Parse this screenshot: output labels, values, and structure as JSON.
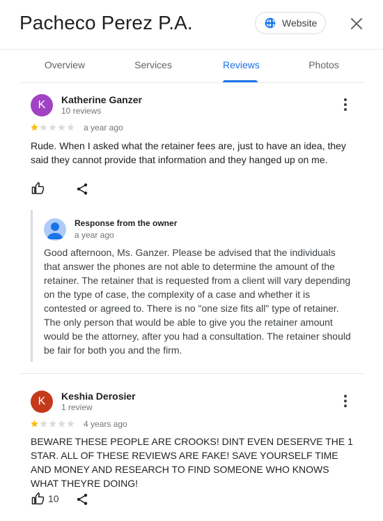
{
  "header": {
    "title": "Pacheco Perez P.A.",
    "website_label": "Website",
    "website_icon": "globe-icon",
    "close_icon": "close-icon"
  },
  "tabs": [
    {
      "label": "Overview",
      "active": false
    },
    {
      "label": "Services",
      "active": false
    },
    {
      "label": "Reviews",
      "active": true
    },
    {
      "label": "Photos",
      "active": false
    }
  ],
  "reviews": [
    {
      "avatar_letter": "K",
      "avatar_color": "#a142c4",
      "name": "Katherine Ganzer",
      "review_count": "10 reviews",
      "rating": 1,
      "date": "a year ago",
      "text": "Rude. When I asked what the retainer fees are, just to have an idea, they said they cannot provide that information and they hanged up on me.",
      "like_count": "",
      "owner_response": {
        "title": "Response from the owner",
        "date": "a year ago",
        "text": "Good afternoon, Ms. Ganzer. Please be advised that the individuals that answer the phones are not able to determine the amount of the retainer. The retainer that is requested from a client will vary depending on the type of case, the complexity of a case and whether it is contested or agreed to. There is no \"one size fits all\" type of retainer. The only person that would be able to give you the retainer amount would be the attorney, after you had a consultation. The retainer should be fair for both you and the firm."
      }
    },
    {
      "avatar_letter": "K",
      "avatar_color": "#c5391b",
      "name": "Keshia Derosier",
      "review_count": "1 review",
      "rating": 1,
      "date": "4 years ago",
      "text": "BEWARE THESE PEOPLE ARE CROOKS! DINT EVEN DESERVE THE 1 STAR. ALL OF THESE REVIEWS ARE FAKE! SAVE YOURSELF TIME AND MONEY AND RESEARCH TO FIND SOMEONE WHO KNOWS WHAT THEYRE DOING!",
      "like_count": "10"
    }
  ],
  "colors": {
    "accent": "#1a73e8",
    "star_filled": "#fbbc04",
    "star_empty": "#dadce0"
  }
}
